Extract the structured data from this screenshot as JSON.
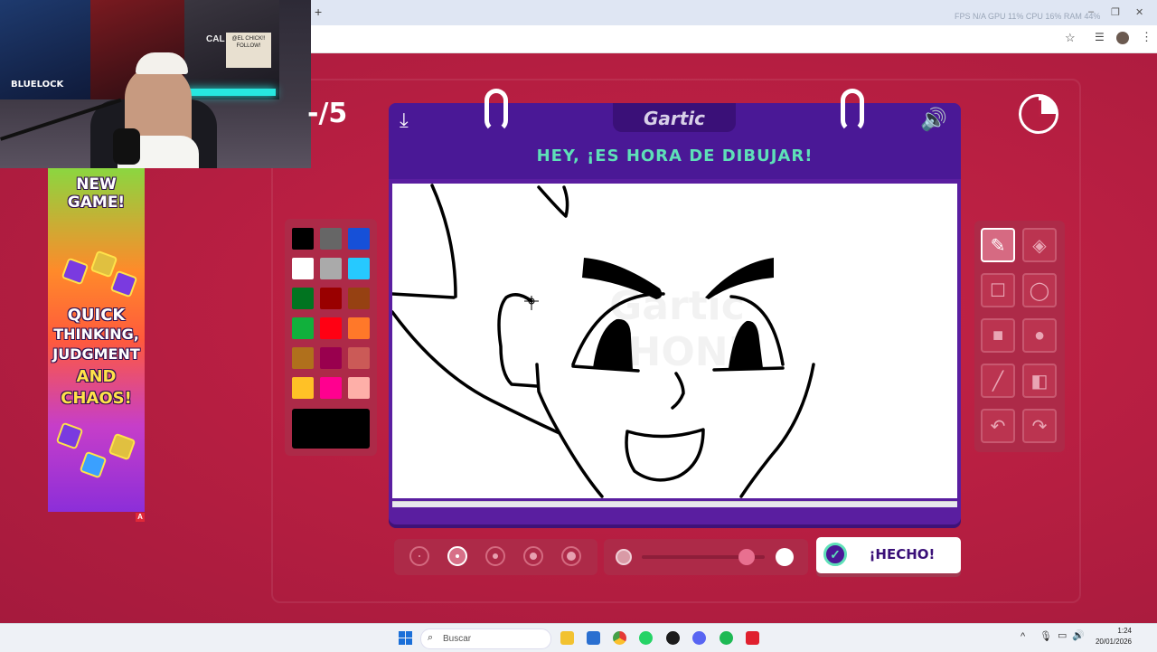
{
  "browser": {
    "new_tab_symbol": "+",
    "overlay_stats": "FPS N/A   GPU 11%   CPU 16%   RAM 44%",
    "window_controls": [
      "–",
      "❐",
      "✕"
    ],
    "toolbar_icons": [
      "star-icon",
      "playlist-icon",
      "profile-avatar",
      "menu-icon"
    ]
  },
  "webcam": {
    "poster_left_text": "BLUELOCK",
    "poster_sign_text": "@EL CHICK!! FOLLOW!",
    "poster_cal": "CAL"
  },
  "ad": {
    "headline": "NEW GAME!",
    "line1": "QUICK",
    "line2": "THINKING,",
    "line3": "JUDGMENT",
    "line4": "AND",
    "line5": "CHAOS!",
    "badge": "A"
  },
  "game": {
    "round_indicator": "-/5",
    "logo": "Gartic",
    "prompt": "HEY, ¡ES HORA DE DIBUJAR!",
    "done_label": "¡HECHO!",
    "watermark": "Gartic PHONE",
    "colors": {
      "accent_teal": "#5ee0b8",
      "notebook_purple": "#4a1896",
      "background": "#c42548"
    },
    "palette": [
      "#000000",
      "#666666",
      "#1650d8",
      "#ffffff",
      "#aaaaaa",
      "#26c9ff",
      "#017420",
      "#990000",
      "#964112",
      "#11b03c",
      "#ff0013",
      "#ff7829",
      "#b0701c",
      "#99004e",
      "#cb5a57",
      "#ffc126",
      "#ff008f",
      "#feafa8"
    ],
    "selected_color": "#000000",
    "tools": [
      {
        "name": "pencil-tool",
        "icon": "✎",
        "active": true
      },
      {
        "name": "eraser-tool",
        "icon": "◈",
        "active": false
      },
      {
        "name": "rect-outline-tool",
        "icon": "☐",
        "active": false
      },
      {
        "name": "ellipse-outline-tool",
        "icon": "◯",
        "active": false
      },
      {
        "name": "rect-fill-tool",
        "icon": "■",
        "active": false
      },
      {
        "name": "ellipse-fill-tool",
        "icon": "●",
        "active": false
      },
      {
        "name": "line-tool",
        "icon": "╱",
        "active": false
      },
      {
        "name": "fill-bucket-tool",
        "icon": "◧",
        "active": false
      },
      {
        "name": "undo-tool",
        "icon": "↶",
        "active": false
      },
      {
        "name": "redo-tool",
        "icon": "↷",
        "active": false
      }
    ],
    "brush_sizes_count": 5,
    "selected_brush_size_index": 1,
    "opacity_level": 0.85
  },
  "taskbar": {
    "search_placeholder": "Buscar",
    "time": "1:24",
    "date": "20/01/2026",
    "tray_symbols": [
      "^",
      "🎙",
      "▭",
      "🔊"
    ]
  }
}
